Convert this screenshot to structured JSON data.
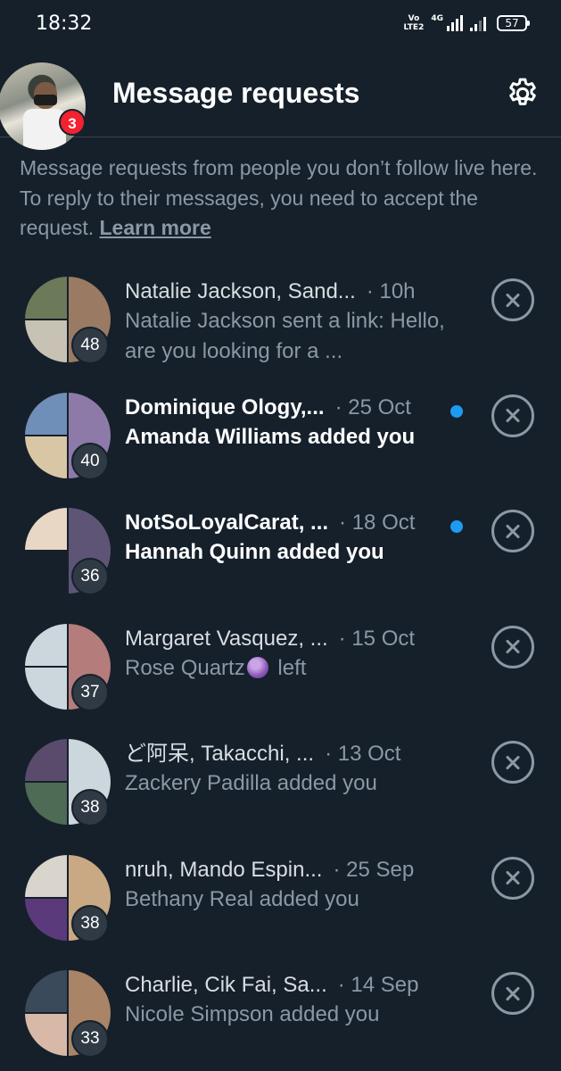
{
  "status_bar": {
    "time": "18:32",
    "volte_top": "Vo",
    "volte_bottom": "LTE2",
    "network": "4G",
    "battery": "57"
  },
  "header": {
    "title": "Message requests",
    "notification_count": "3",
    "icons": {
      "settings": "gear-icon",
      "avatar": "profile-avatar"
    }
  },
  "info": {
    "text": "Message requests from people you don’t follow live here. To reply to their messages, you need to accept the request. ",
    "link": "Learn more"
  },
  "requests": [
    {
      "names": "Natalie Jackson, Sand...",
      "time": "· 10h",
      "message": "Natalie Jackson sent a link: Hello, are you looking for a ...",
      "count": "48",
      "unread": false,
      "colors": [
        "#6d7a5a",
        "#c7c2b4",
        "#9a7a63"
      ]
    },
    {
      "names": "Dominique Ology,...",
      "time": "· 25 Oct",
      "message": "Amanda Williams added you",
      "count": "40",
      "unread": true,
      "colors": [
        "#6f8fb8",
        "#d9c6a5",
        "#8d7aa8"
      ]
    },
    {
      "names": "NotSoLoyalCarat, ...",
      "time": "· 18 Oct",
      "message": "Hannah Quinn added you",
      "count": "36",
      "unread": true,
      "colors": [
        "#e7d7c4",
        "#15202b",
        "#5d5476"
      ]
    },
    {
      "names": "Margaret Vasquez, ...",
      "time": "· 15 Oct",
      "message_before": "Rose Quartz",
      "message_emoji": "crystal-ball",
      "message_after": " left",
      "count": "37",
      "unread": false,
      "colors": [
        "#ccd6dd",
        "#ccd6dd",
        "#b47c7a"
      ]
    },
    {
      "names": "ど阿呆, Takacchi, ...",
      "time": "· 13 Oct",
      "message": "Zackery Padilla added you",
      "count": "38",
      "unread": false,
      "colors": [
        "#5a4a6b",
        "#4d6b55",
        "#ccd6dd"
      ]
    },
    {
      "names": "nruh, Mando Espin...",
      "time": "· 25 Sep",
      "message": "Bethany Real added you",
      "count": "38",
      "unread": false,
      "colors": [
        "#d9d4cc",
        "#5a3a7a",
        "#c9a983"
      ]
    },
    {
      "names": "Charlie, Cik Fai, Sa...",
      "time": "· 14 Sep",
      "message": "Nicole Simpson added you",
      "count": "33",
      "unread": false,
      "colors": [
        "#3a4a5a",
        "#d8b9a8",
        "#a98467"
      ]
    }
  ]
}
